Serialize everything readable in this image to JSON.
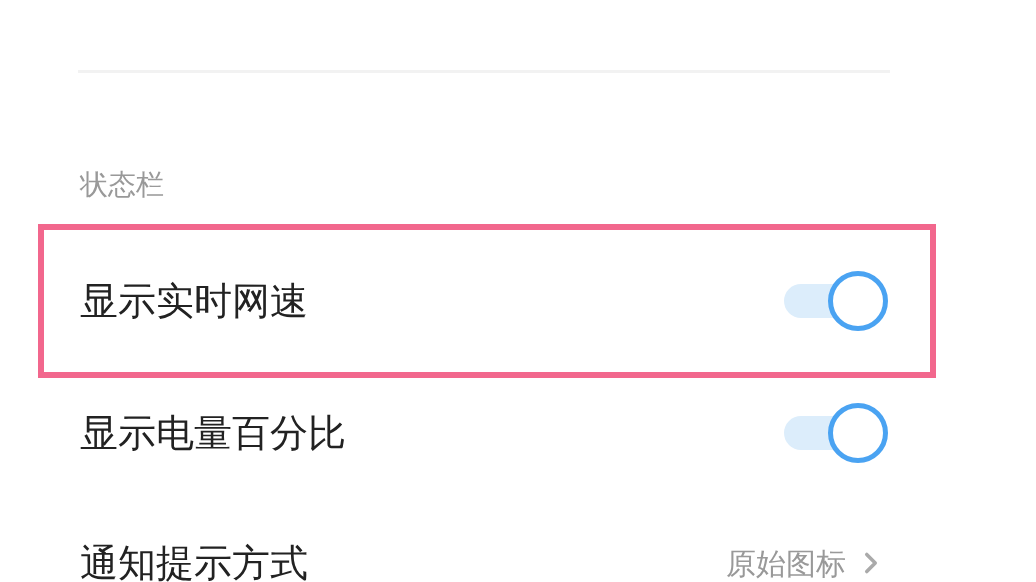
{
  "section": {
    "title": "状态栏"
  },
  "rows": [
    {
      "kind": "toggle",
      "label": "显示实时网速",
      "on": true,
      "highlighted": true
    },
    {
      "kind": "toggle",
      "label": "显示电量百分比",
      "on": true,
      "highlighted": false
    },
    {
      "kind": "link",
      "label": "通知提示方式",
      "value": "原始图标",
      "highlighted": false
    }
  ]
}
